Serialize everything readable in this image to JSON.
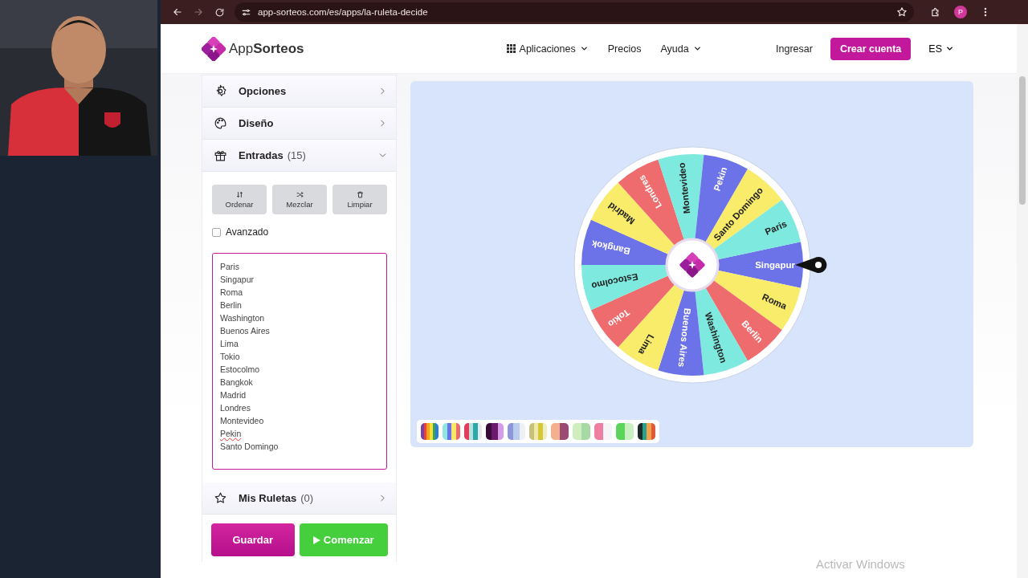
{
  "browser": {
    "url": "app-sorteos.com/es/apps/la-ruleta-decide",
    "forward_disabled": true,
    "profile_initial": "P"
  },
  "site_header": {
    "logo": "App**Sorteos**",
    "nav": [
      {
        "label": "Aplicaciones",
        "dropdown": true
      },
      {
        "label": "Precios",
        "dropdown": false
      },
      {
        "label": "Ayuda",
        "dropdown": true
      }
    ],
    "login": "Ingresar",
    "signup": "Crear cuenta",
    "language": "ES"
  },
  "accordion": [
    {
      "label": "Opciones",
      "expanded": false
    },
    {
      "label": "Diseño",
      "expanded": false
    },
    {
      "label": "Entradas",
      "count": "(15)",
      "expanded": true
    },
    {
      "label": "Mis Ruletas",
      "count": "(0)",
      "expanded": false
    }
  ],
  "entry_tools": [
    "Ordenar",
    "Mezclar",
    "Limpiar"
  ],
  "advanced": {
    "label": "Avanzado",
    "checked": false
  },
  "entries": [
    {
      "text": "Paris",
      "misspelled": false
    },
    {
      "text": "Singapur",
      "misspelled": false
    },
    {
      "text": "Roma",
      "misspelled": false
    },
    {
      "text": "Berlin",
      "misspelled": false
    },
    {
      "text": "Washington",
      "misspelled": false
    },
    {
      "text": "Buenos Aires",
      "misspelled": false
    },
    {
      "text": "Lima",
      "misspelled": false
    },
    {
      "text": "Tokio",
      "misspelled": false
    },
    {
      "text": "Estocolmo",
      "misspelled": false
    },
    {
      "text": "Bangkok",
      "misspelled": false
    },
    {
      "text": "Madrid",
      "misspelled": false
    },
    {
      "text": "Londres",
      "misspelled": false
    },
    {
      "text": "Montevideo",
      "misspelled": false
    },
    {
      "text": "Pekin",
      "misspelled": true
    },
    {
      "text": "Santo Domingo",
      "misspelled": false
    }
  ],
  "actions": {
    "save": "Guardar",
    "start": "Comenzar"
  },
  "wheel": {
    "segments": [
      {
        "label": "Singapur",
        "color": "#6c72e8"
      },
      {
        "label": "Roma",
        "color": "#f8ec6a"
      },
      {
        "label": "Berlin",
        "color": "#ee6b6e"
      },
      {
        "label": "Washington",
        "color": "#7eeadf"
      },
      {
        "label": "Buenos Aires",
        "color": "#6c72e8"
      },
      {
        "label": "Lima",
        "color": "#f8ec6a"
      },
      {
        "label": "Tokio",
        "color": "#ee6b6e"
      },
      {
        "label": "Estocolmo",
        "color": "#7eeadf"
      },
      {
        "label": "Bangkok",
        "color": "#6c72e8"
      },
      {
        "label": "Madrid",
        "color": "#f8ec6a"
      },
      {
        "label": "Londres",
        "color": "#ee6b6e"
      },
      {
        "label": "Montevideo",
        "color": "#7eeadf"
      },
      {
        "label": "Pekin",
        "color": "#6c72e8"
      },
      {
        "label": "Santo Domingo",
        "color": "#f8ec6a"
      },
      {
        "label": "Paris",
        "color": "#7eeadf"
      }
    ]
  },
  "palettes": [
    {
      "stripes": [
        {
          "color": "#7a3fa0"
        },
        {
          "color": "#e8433f"
        },
        {
          "color": "#f7a21b"
        },
        {
          "color": "#f5e03a"
        },
        {
          "color": "#3aa35b"
        },
        {
          "color": "#2f7fd0"
        }
      ]
    },
    {
      "stripes": [
        {
          "color": "#8ee6e0"
        },
        {
          "color": "#6c72e8"
        },
        {
          "color": "#f5e86a"
        },
        {
          "color": "#ee6b6b"
        }
      ]
    },
    {
      "stripes": [
        {
          "color": "#e23c5a"
        },
        {
          "color": "#b8e0e0"
        },
        {
          "color": "#2aa9a9"
        },
        {
          "color": "#e8e8f0"
        }
      ]
    },
    {
      "stripes": [
        {
          "color": "#3a0b3a"
        },
        {
          "color": "#6b1a6b"
        },
        {
          "color": "#d69be8"
        }
      ]
    },
    {
      "stripes": [
        {
          "color": "#8d96d8"
        },
        {
          "color": "#b8cdf0"
        },
        {
          "color": "#eef0f6"
        }
      ]
    },
    {
      "stripes": [
        {
          "color": "#c9c07a"
        },
        {
          "color": "#efe9a8"
        },
        {
          "color": "#d4c83a"
        },
        {
          "color": "#f0eec0"
        }
      ]
    },
    {
      "stripes": [
        {
          "color": "#f2b08e"
        },
        {
          "color": "#9b4b72"
        }
      ]
    },
    {
      "stripes": [
        {
          "color": "#cfeec0"
        },
        {
          "color": "#a7d9a5"
        }
      ]
    },
    {
      "stripes": [
        {
          "color": "#ef7fa0"
        },
        {
          "color": "#f5f5f7"
        }
      ]
    },
    {
      "stripes": [
        {
          "color": "#5bd45b"
        },
        {
          "color": "#c8f0c0"
        }
      ]
    },
    {
      "stripes": [
        {
          "color": "#1d2b2b"
        },
        {
          "color": "#2aa08a"
        },
        {
          "color": "#f0a24a"
        },
        {
          "color": "#e05a3a"
        }
      ]
    }
  ],
  "os_notice": "Activar Windows"
}
